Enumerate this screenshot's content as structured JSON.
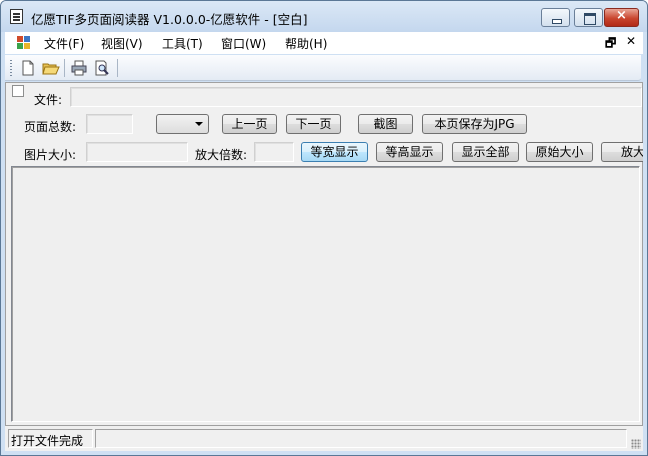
{
  "window": {
    "title": "亿愿TIF多页面阅读器 V1.0.0.0-亿愿软件 - [空白]",
    "close_glyph": "×"
  },
  "menubar": {
    "items": [
      {
        "label": "文件(F)"
      },
      {
        "label": "视图(V)"
      },
      {
        "label": "工具(T)"
      },
      {
        "label": "窗口(W)"
      },
      {
        "label": "帮助(H)"
      }
    ],
    "restore_glyph": "🗗",
    "close_glyph": "✕"
  },
  "toolbar": {
    "buttons": [
      {
        "icon": "new-file-icon"
      },
      {
        "icon": "open-folder-icon"
      },
      {
        "icon": "print-icon"
      },
      {
        "icon": "print-preview-icon"
      }
    ]
  },
  "form": {
    "file_label": "文件:",
    "file_value": "",
    "page_count_label": "页面总数:",
    "page_count_value": "",
    "page_select_value": "",
    "prev_page": "上一页",
    "next_page": "下一页",
    "screenshot": "截图",
    "save_jpg": "本页保存为JPG",
    "image_size_label": "图片大小:",
    "image_size_value": "",
    "zoom_label": "放大倍数:",
    "zoom_value": "",
    "fit_width": "等宽显示",
    "fit_height": "等高显示",
    "show_all": "显示全部",
    "original_size": "原始大小",
    "zoom_in": "放大"
  },
  "status": {
    "message": "打开文件完成",
    "secondary": ""
  }
}
